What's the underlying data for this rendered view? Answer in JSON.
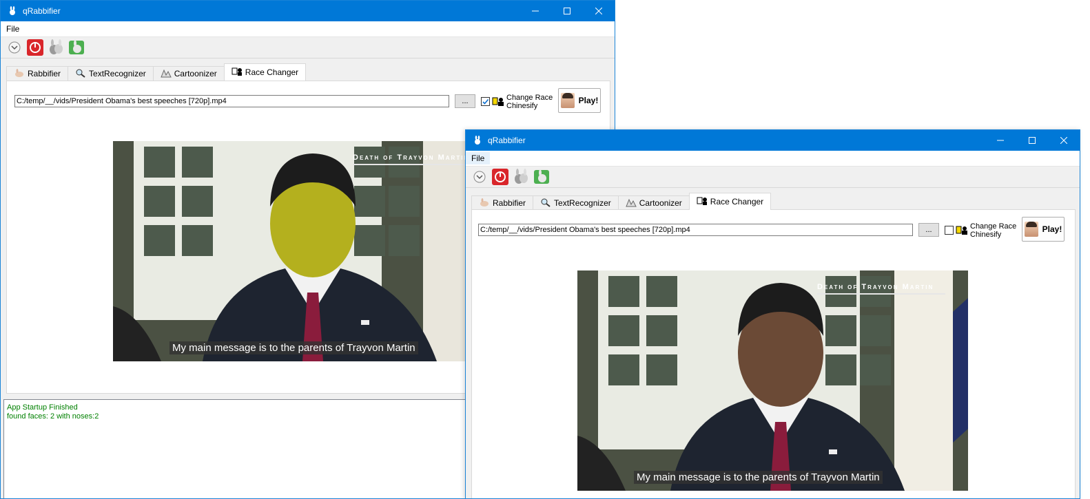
{
  "windows": [
    {
      "title": "qRabbifier",
      "menu": [
        "File"
      ],
      "tabs": [
        {
          "label": "Rabbifier",
          "icon": "rabbit-icon"
        },
        {
          "label": "TextRecognizer",
          "icon": "magnifier-icon"
        },
        {
          "label": "Cartoonizer",
          "icon": "cartoon-icon"
        },
        {
          "label": "Race Changer",
          "icon": "race-icon",
          "active": true
        }
      ],
      "path_value": "C:/temp/__/vids/President Obama's best speeches [720p].mp4",
      "browse_label": "...",
      "checkbox_checked": true,
      "checkbox_label_1": "Change Race",
      "checkbox_label_2": "Chinesify",
      "play_label": "Play!",
      "video": {
        "overlay_title": "Death of Trayvon Martin",
        "subtitle": "My main message is to the parents of Trayvon Martin",
        "face_tint": "yellowed"
      },
      "log_lines": [
        "App Startup Finished",
        "found faces: 2 with noses:2"
      ]
    },
    {
      "title": "qRabbifier",
      "menu": [
        "File"
      ],
      "tabs": [
        {
          "label": "Rabbifier",
          "icon": "rabbit-icon"
        },
        {
          "label": "TextRecognizer",
          "icon": "magnifier-icon"
        },
        {
          "label": "Cartoonizer",
          "icon": "cartoon-icon"
        },
        {
          "label": "Race Changer",
          "icon": "race-icon",
          "active": true
        }
      ],
      "path_value": "C:/temp/__/vids/President Obama's best speeches [720p].mp4",
      "browse_label": "...",
      "checkbox_checked": false,
      "checkbox_label_1": "Change Race",
      "checkbox_label_2": "Chinesify",
      "play_label": "Play!",
      "video": {
        "overlay_title": "Death of Trayvon Martin",
        "subtitle": "My main message is to the parents of Trayvon Martin",
        "face_tint": "natural"
      }
    }
  ],
  "colors": {
    "titlebar": "#0078d7",
    "log_text": "#008000",
    "stop_button": "#d9262b",
    "green_icon": "#4caf50"
  }
}
